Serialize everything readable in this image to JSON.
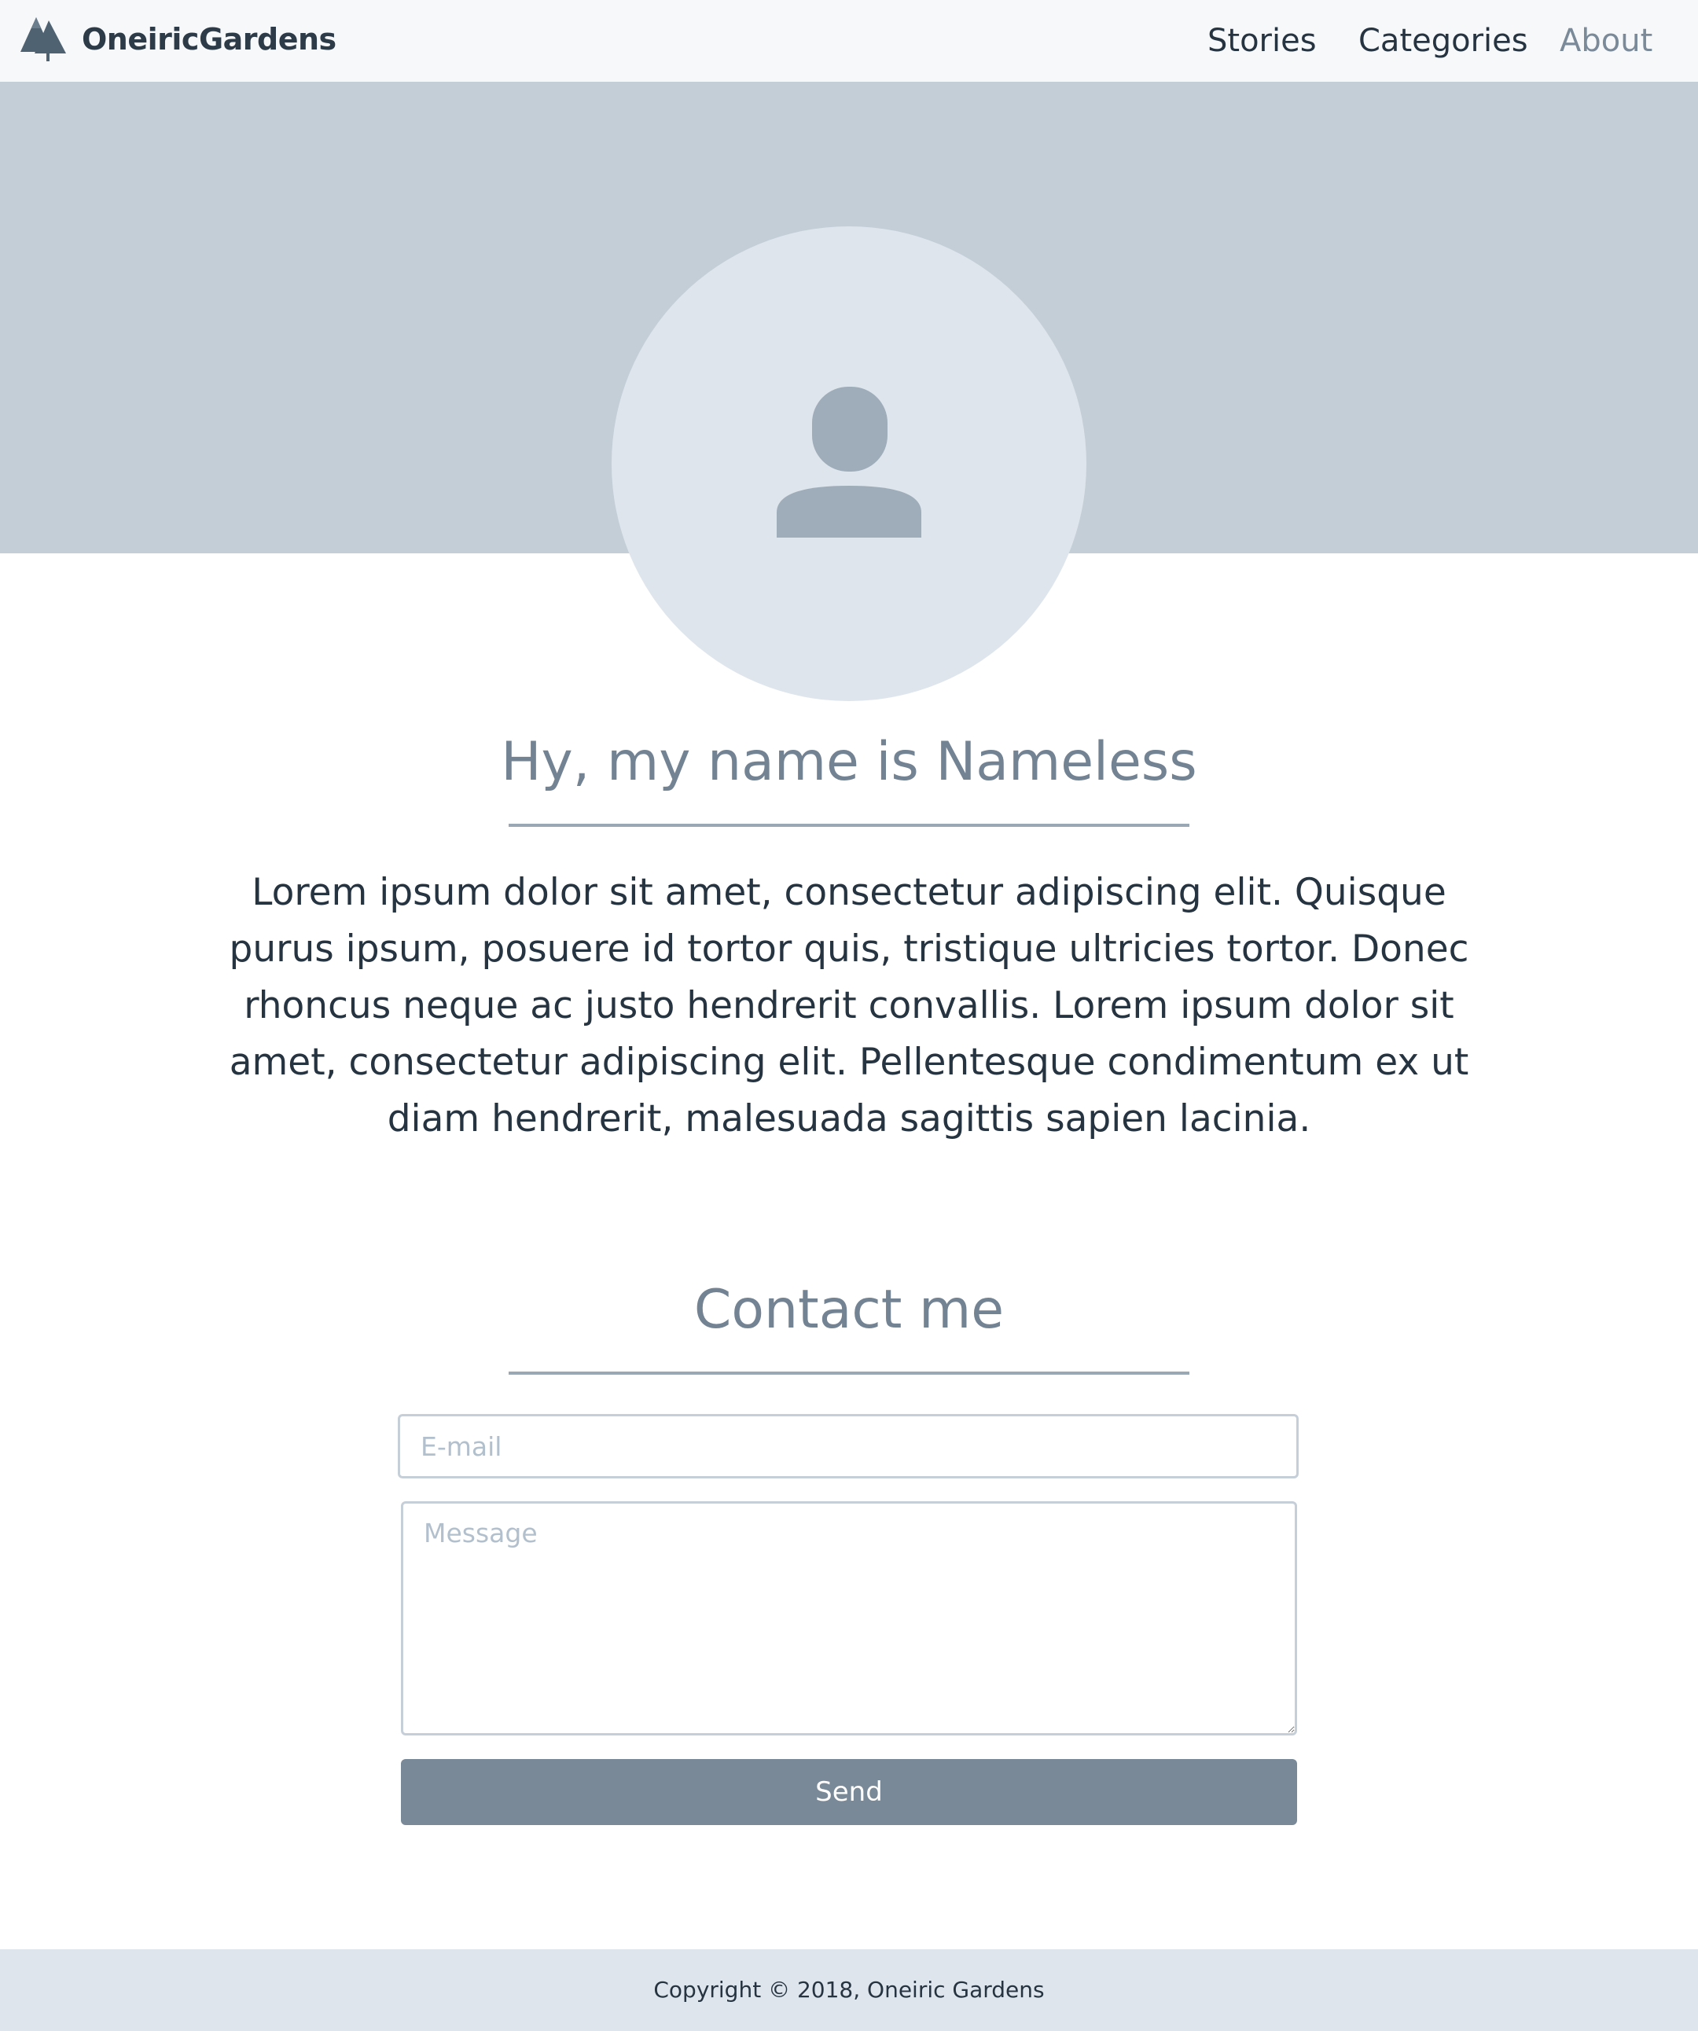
{
  "navbar": {
    "brand": "OneiricGardens",
    "brand_icon": "trees-icon",
    "links": [
      {
        "label": "Stories"
      },
      {
        "label": "Categories"
      },
      {
        "label": "About",
        "active": true
      }
    ]
  },
  "hero": {
    "avatar_icon": "user-icon"
  },
  "intro": {
    "heading": "Hy, my name is Nameless",
    "text": "Lorem ipsum dolor sit amet, consectetur adipiscing elit. Quisque purus ipsum, posuere id tortor quis, tristique ultricies tortor. Donec rhoncus neque ac justo hendrerit convallis. Lorem ipsum dolor sit amet, consectetur adipiscing elit. Pellentesque condimentum ex ut diam hendrerit, malesuada sagittis sapien lacinia."
  },
  "contact": {
    "heading": "Contact me",
    "email_placeholder": "E-mail",
    "email_value": "",
    "message_placeholder": "Message",
    "message_value": "",
    "send_label": "Send"
  },
  "footer": {
    "copyright": "Copyright © 2018, Oneiric Gardens"
  },
  "colors": {
    "navbar_bg": "#f7f8fa",
    "hero_band": "#c3ced7",
    "avatar_bg": "#dfe5ed",
    "avatar_icon": "#9eadb9",
    "heading": "#738393",
    "rule": "#9aa8b5",
    "body_text": "#263442",
    "accent_button": "#798997",
    "footer_bg": "#dfe5ed",
    "active_nav": "#7b8a99"
  }
}
